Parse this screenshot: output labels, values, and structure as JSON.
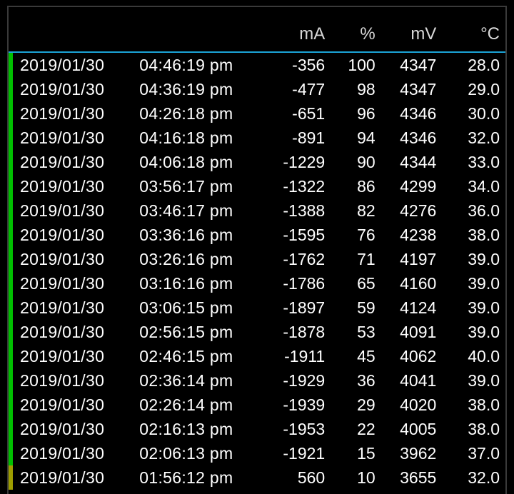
{
  "headers": {
    "ma": "mA",
    "pct": "%",
    "mv": "mV",
    "temp": "°C"
  },
  "rows": [
    {
      "marker": "green",
      "date": "2019/01/30",
      "time": "04:46:19 pm",
      "ma": "-356",
      "pct": "100",
      "mv": "4347",
      "temp": "28.0"
    },
    {
      "marker": "green",
      "date": "2019/01/30",
      "time": "04:36:19 pm",
      "ma": "-477",
      "pct": "98",
      "mv": "4347",
      "temp": "29.0"
    },
    {
      "marker": "green",
      "date": "2019/01/30",
      "time": "04:26:18 pm",
      "ma": "-651",
      "pct": "96",
      "mv": "4346",
      "temp": "30.0"
    },
    {
      "marker": "green",
      "date": "2019/01/30",
      "time": "04:16:18 pm",
      "ma": "-891",
      "pct": "94",
      "mv": "4346",
      "temp": "32.0"
    },
    {
      "marker": "green",
      "date": "2019/01/30",
      "time": "04:06:18 pm",
      "ma": "-1229",
      "pct": "90",
      "mv": "4344",
      "temp": "33.0"
    },
    {
      "marker": "green",
      "date": "2019/01/30",
      "time": "03:56:17 pm",
      "ma": "-1322",
      "pct": "86",
      "mv": "4299",
      "temp": "34.0"
    },
    {
      "marker": "green",
      "date": "2019/01/30",
      "time": "03:46:17 pm",
      "ma": "-1388",
      "pct": "82",
      "mv": "4276",
      "temp": "36.0"
    },
    {
      "marker": "green",
      "date": "2019/01/30",
      "time": "03:36:16 pm",
      "ma": "-1595",
      "pct": "76",
      "mv": "4238",
      "temp": "38.0"
    },
    {
      "marker": "green",
      "date": "2019/01/30",
      "time": "03:26:16 pm",
      "ma": "-1762",
      "pct": "71",
      "mv": "4197",
      "temp": "39.0"
    },
    {
      "marker": "green",
      "date": "2019/01/30",
      "time": "03:16:16 pm",
      "ma": "-1786",
      "pct": "65",
      "mv": "4160",
      "temp": "39.0"
    },
    {
      "marker": "green",
      "date": "2019/01/30",
      "time": "03:06:15 pm",
      "ma": "-1897",
      "pct": "59",
      "mv": "4124",
      "temp": "39.0"
    },
    {
      "marker": "green",
      "date": "2019/01/30",
      "time": "02:56:15 pm",
      "ma": "-1878",
      "pct": "53",
      "mv": "4091",
      "temp": "39.0"
    },
    {
      "marker": "green",
      "date": "2019/01/30",
      "time": "02:46:15 pm",
      "ma": "-1911",
      "pct": "45",
      "mv": "4062",
      "temp": "40.0"
    },
    {
      "marker": "green",
      "date": "2019/01/30",
      "time": "02:36:14 pm",
      "ma": "-1929",
      "pct": "36",
      "mv": "4041",
      "temp": "39.0"
    },
    {
      "marker": "green",
      "date": "2019/01/30",
      "time": "02:26:14 pm",
      "ma": "-1939",
      "pct": "29",
      "mv": "4020",
      "temp": "38.0"
    },
    {
      "marker": "green",
      "date": "2019/01/30",
      "time": "02:16:13 pm",
      "ma": "-1953",
      "pct": "22",
      "mv": "4005",
      "temp": "38.0"
    },
    {
      "marker": "green",
      "date": "2019/01/30",
      "time": "02:06:13 pm",
      "ma": "-1921",
      "pct": "15",
      "mv": "3962",
      "temp": "37.0"
    },
    {
      "marker": "olive",
      "date": "2019/01/30",
      "time": "01:56:12 pm",
      "ma": "560",
      "pct": "10",
      "mv": "3655",
      "temp": "32.0"
    }
  ]
}
